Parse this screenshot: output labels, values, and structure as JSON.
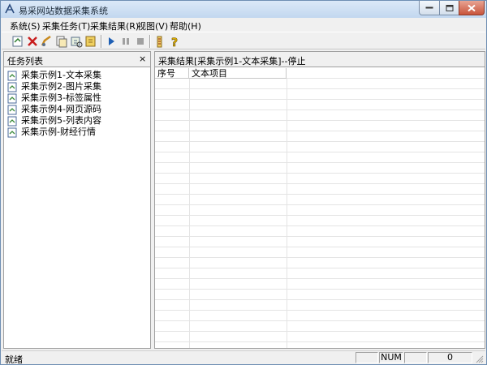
{
  "window": {
    "title": "易采网站数据采集系统"
  },
  "menu": [
    {
      "label": "系统(S)"
    },
    {
      "label": "采集任务(T)"
    },
    {
      "label": "采集结果(R)"
    },
    {
      "label": "视图(V)"
    },
    {
      "label": "帮助(H)"
    }
  ],
  "toolbar": {
    "icons": [
      "new-task-icon",
      "delete-icon",
      "edit-icon",
      "copy-icon",
      "find-icon",
      "export-icon",
      "start-icon",
      "pause-icon",
      "stop-icon",
      "list-icon",
      "help-icon"
    ]
  },
  "task_pane": {
    "title": "任务列表",
    "close_glyph": "×",
    "items": [
      {
        "label": "采集示例1-文本采集"
      },
      {
        "label": "采集示例2-图片采集"
      },
      {
        "label": "采集示例3-标签属性"
      },
      {
        "label": "采集示例4-网页源码"
      },
      {
        "label": "采集示例5-列表内容"
      },
      {
        "label": "采集示例-财经行情"
      }
    ]
  },
  "result_pane": {
    "title": "采集结果[采集示例1-文本采集]--停止",
    "columns": [
      "序号",
      "文本项目"
    ]
  },
  "statusbar": {
    "text": "就绪",
    "num": "NUM",
    "count": "0"
  },
  "colors": {
    "play": "#1f5fb4",
    "delete": "#c81e1e",
    "help": "#e0b000"
  }
}
